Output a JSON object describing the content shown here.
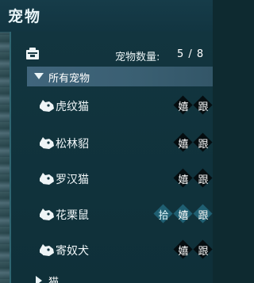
{
  "window": {
    "title": "宠物"
  },
  "summary": {
    "icon": "pet-bag-icon",
    "count_label": "宠物数量:",
    "count_value": "5 / 8"
  },
  "groups": [
    {
      "label": "所有宠物",
      "expanded": true,
      "pets": [
        {
          "name": "虎纹猫",
          "icon": "pet-head-icon",
          "actions": [
            "嬉",
            "跟"
          ]
        },
        {
          "name": "松林貂",
          "icon": "pet-head-icon",
          "actions": [
            "嬉",
            "跟"
          ]
        },
        {
          "name": "罗汉猫",
          "icon": "pet-head-icon",
          "actions": [
            "嬉",
            "跟"
          ]
        },
        {
          "name": "花栗鼠",
          "icon": "pet-head-icon",
          "actions": [
            "拾",
            "嬉",
            "跟"
          ]
        },
        {
          "name": "寄奴犬",
          "icon": "pet-head-icon",
          "actions": [
            "嬉",
            "跟"
          ]
        }
      ]
    },
    {
      "label": "猫",
      "expanded": false
    }
  ],
  "colors": {
    "title_bg": "#163c49",
    "panel_bg": "#12353f",
    "group_header_bg": "#40657c",
    "action_bg": "#050d10",
    "pick_action_bg": "#1f5f72"
  }
}
